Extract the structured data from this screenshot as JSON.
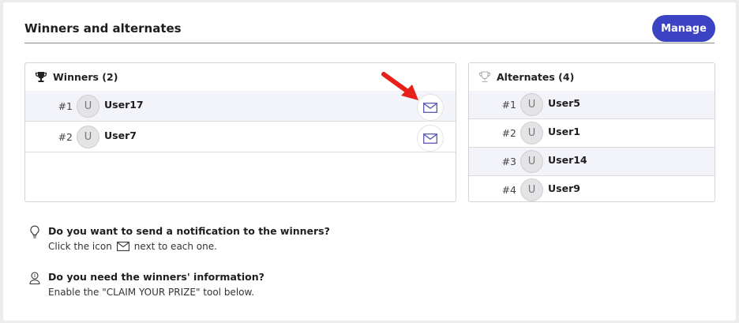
{
  "header": {
    "title": "Winners and alternates",
    "manage_label": "Manage"
  },
  "winners": {
    "title": "Winners (2)",
    "icon": "trophy-icon",
    "items": [
      {
        "rank": "#1",
        "initial": "U",
        "name": "User17"
      },
      {
        "rank": "#2",
        "initial": "U",
        "name": "User7"
      }
    ]
  },
  "alternates": {
    "title": "Alternates (4)",
    "icon": "trophy-outline-icon",
    "items": [
      {
        "rank": "#1",
        "initial": "U",
        "name": "User5"
      },
      {
        "rank": "#2",
        "initial": "U",
        "name": "User1"
      },
      {
        "rank": "#3",
        "initial": "U",
        "name": "User14"
      },
      {
        "rank": "#4",
        "initial": "U",
        "name": "User9"
      }
    ]
  },
  "tips": {
    "notify_question": "Do you want to send a notification to the winners?",
    "notify_prefix": "Click the icon",
    "notify_suffix": "next to each one.",
    "info_question": "Do you need the winners' information?",
    "info_answer": "Enable the \"CLAIM YOUR PRIZE\" tool below."
  },
  "colors": {
    "accent": "#3b42c4",
    "mail_icon": "#5a57b8",
    "annotation_arrow": "#e8201a",
    "row_highlight": "#f3f3fa"
  }
}
